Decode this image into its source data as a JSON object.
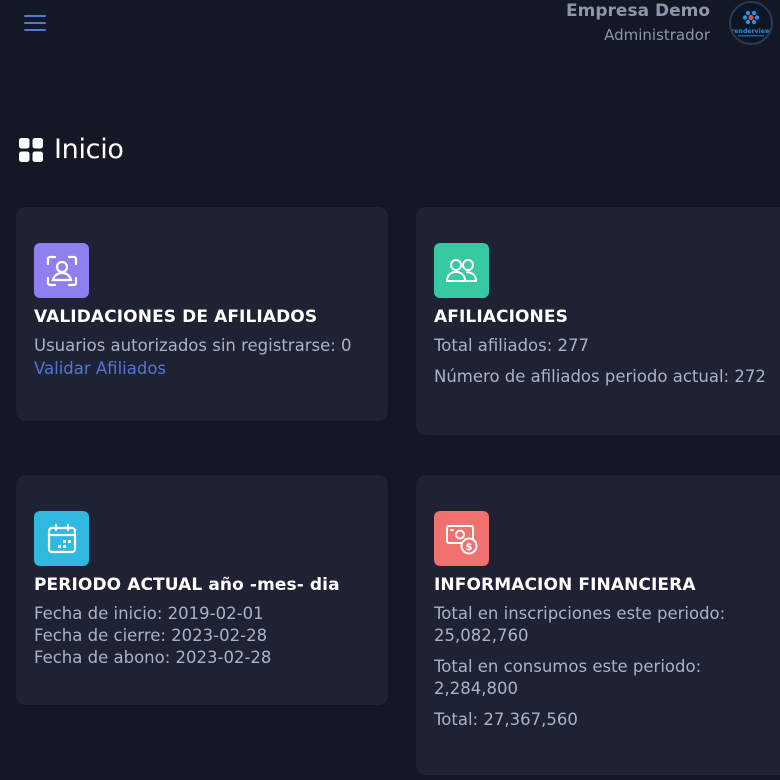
{
  "header": {
    "company": "Empresa Demo",
    "role": "Administrador",
    "avatar_text": "renderview"
  },
  "page": {
    "title": "Inicio"
  },
  "cards": {
    "validaciones": {
      "title": "VALIDACIONES DE AFILIADOS",
      "line1": "Usuarios autorizados sin registrarse: 0",
      "link": "Validar Afiliados",
      "icon": "user-scan-icon",
      "color": "#8f80f0"
    },
    "afiliaciones": {
      "title": "AFILIACIONES",
      "line1": "Total afiliados: 277",
      "line2": "Número de afiliados periodo actual: 272",
      "icon": "users-icon",
      "color": "#36c9a4"
    },
    "periodo": {
      "title": "PERIODO ACTUAL año -mes- dia",
      "line1": "Fecha de inicio: 2019-02-01",
      "line2": "Fecha de cierre: 2023-02-28",
      "line3": "Fecha de abono: 2023-02-28",
      "icon": "calendar-icon",
      "color": "#31b8de"
    },
    "financiera": {
      "title": "INFORMACION FINANCIERA",
      "line1a": "Total en inscripciones este periodo:",
      "line1b": "25,082,760",
      "line2a": "Total en consumos este periodo:",
      "line2b": "2,284,800",
      "line3": "Total: 27,367,560",
      "icon": "money-icon",
      "color": "#f0716e"
    }
  }
}
